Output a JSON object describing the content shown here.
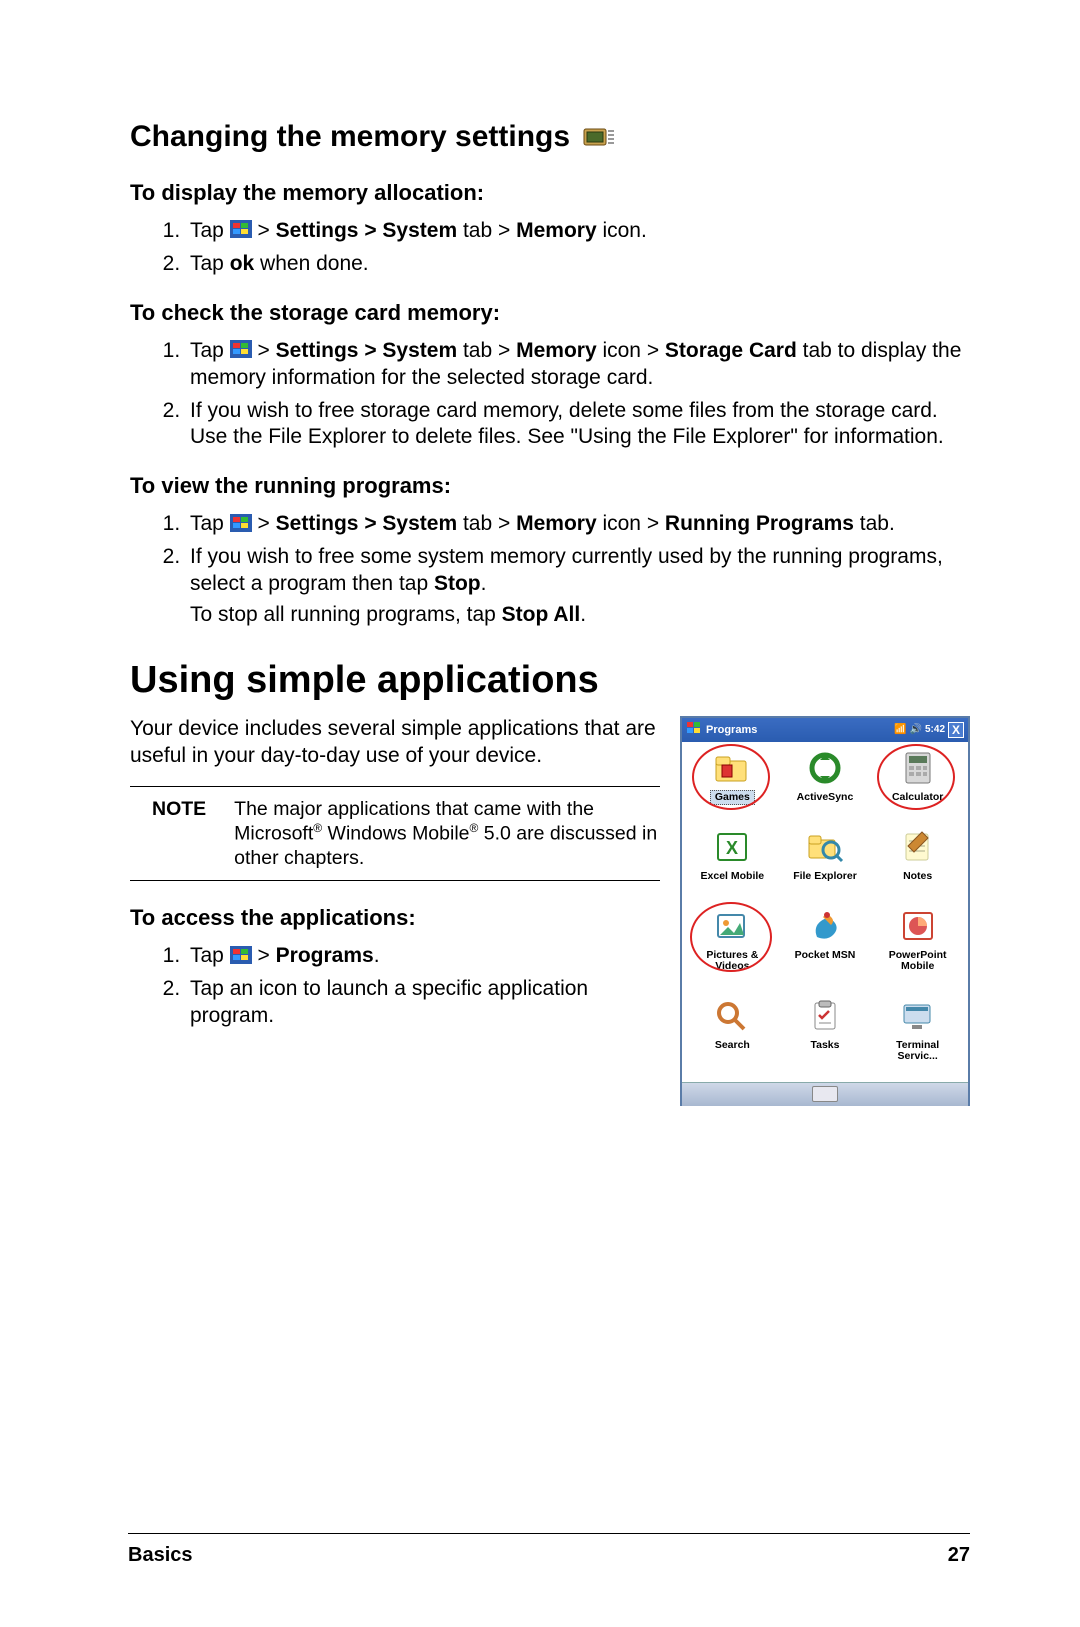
{
  "section1": {
    "title": "Changing the memory settings",
    "sub_a": "To display the memory allocation:",
    "a1_pre": "Tap ",
    "a1_post": " > ",
    "a1_b1": "Settings > System",
    "a1_mid": " tab >  ",
    "a1_b2": "Memory",
    "a1_end": " icon.",
    "a2_pre": "Tap ",
    "a2_b": "ok",
    "a2_end": " when done.",
    "sub_b": "To check the storage card memory:",
    "b1_pre": "Tap ",
    "b1_b1": "Settings > System",
    "b1_m1": " tab > ",
    "b1_b2": "Memory",
    "b1_m2": " icon > ",
    "b1_b3": "Storage Card",
    "b1_m3": " tab to display the memory information for the selected storage card.",
    "b2": "If you wish to free storage card memory, delete some files from the storage card. Use the File Explorer to delete files. See \"Using the File Explorer\" for information.",
    "sub_c": "To view the running programs:",
    "c1_pre": "Tap ",
    "c1_b1": "Settings > System",
    "c1_m1": " tab > ",
    "c1_b2": "Memory",
    "c1_m2": " icon > ",
    "c1_b3": "Running Programs",
    "c1_m3": " tab.",
    "c2_pre": "If you wish to free some system memory currently used by the running programs, select a program then tap ",
    "c2_b": "Stop",
    "c2_end": ".",
    "c2x_pre": "To stop all running programs, tap ",
    "c2x_b": "Stop All",
    "c2x_end": "."
  },
  "section2": {
    "title": "Using simple applications",
    "intro": "Your device includes several simple applications that are useful in your day-to-day use of your device.",
    "note_label": "NOTE",
    "note_text_a": "The major applications that came with the Microsoft",
    "note_text_b": " Windows Mobile",
    "note_text_c": " 5.0 are discussed in other chapters.",
    "reg": "®",
    "sub_d": "To access the applications:",
    "d1_pre": "Tap ",
    "d1_b": "Programs",
    "d1_end": ".",
    "d1_sep": " > ",
    "d2": "Tap an icon to launch a specific application program."
  },
  "screenshot": {
    "titlebar": "Programs",
    "time": "5:42",
    "close": "X",
    "items": [
      {
        "label": "Games"
      },
      {
        "label": "ActiveSync"
      },
      {
        "label": "Calculator"
      },
      {
        "label": "Excel Mobile"
      },
      {
        "label": "File Explorer"
      },
      {
        "label": "Notes"
      },
      {
        "label": "Pictures & Videos"
      },
      {
        "label": "Pocket MSN"
      },
      {
        "label": "PowerPoint Mobile"
      },
      {
        "label": "Search"
      },
      {
        "label": "Tasks"
      },
      {
        "label": "Terminal Servic..."
      }
    ]
  },
  "footer": {
    "left": "Basics",
    "right": "27"
  }
}
